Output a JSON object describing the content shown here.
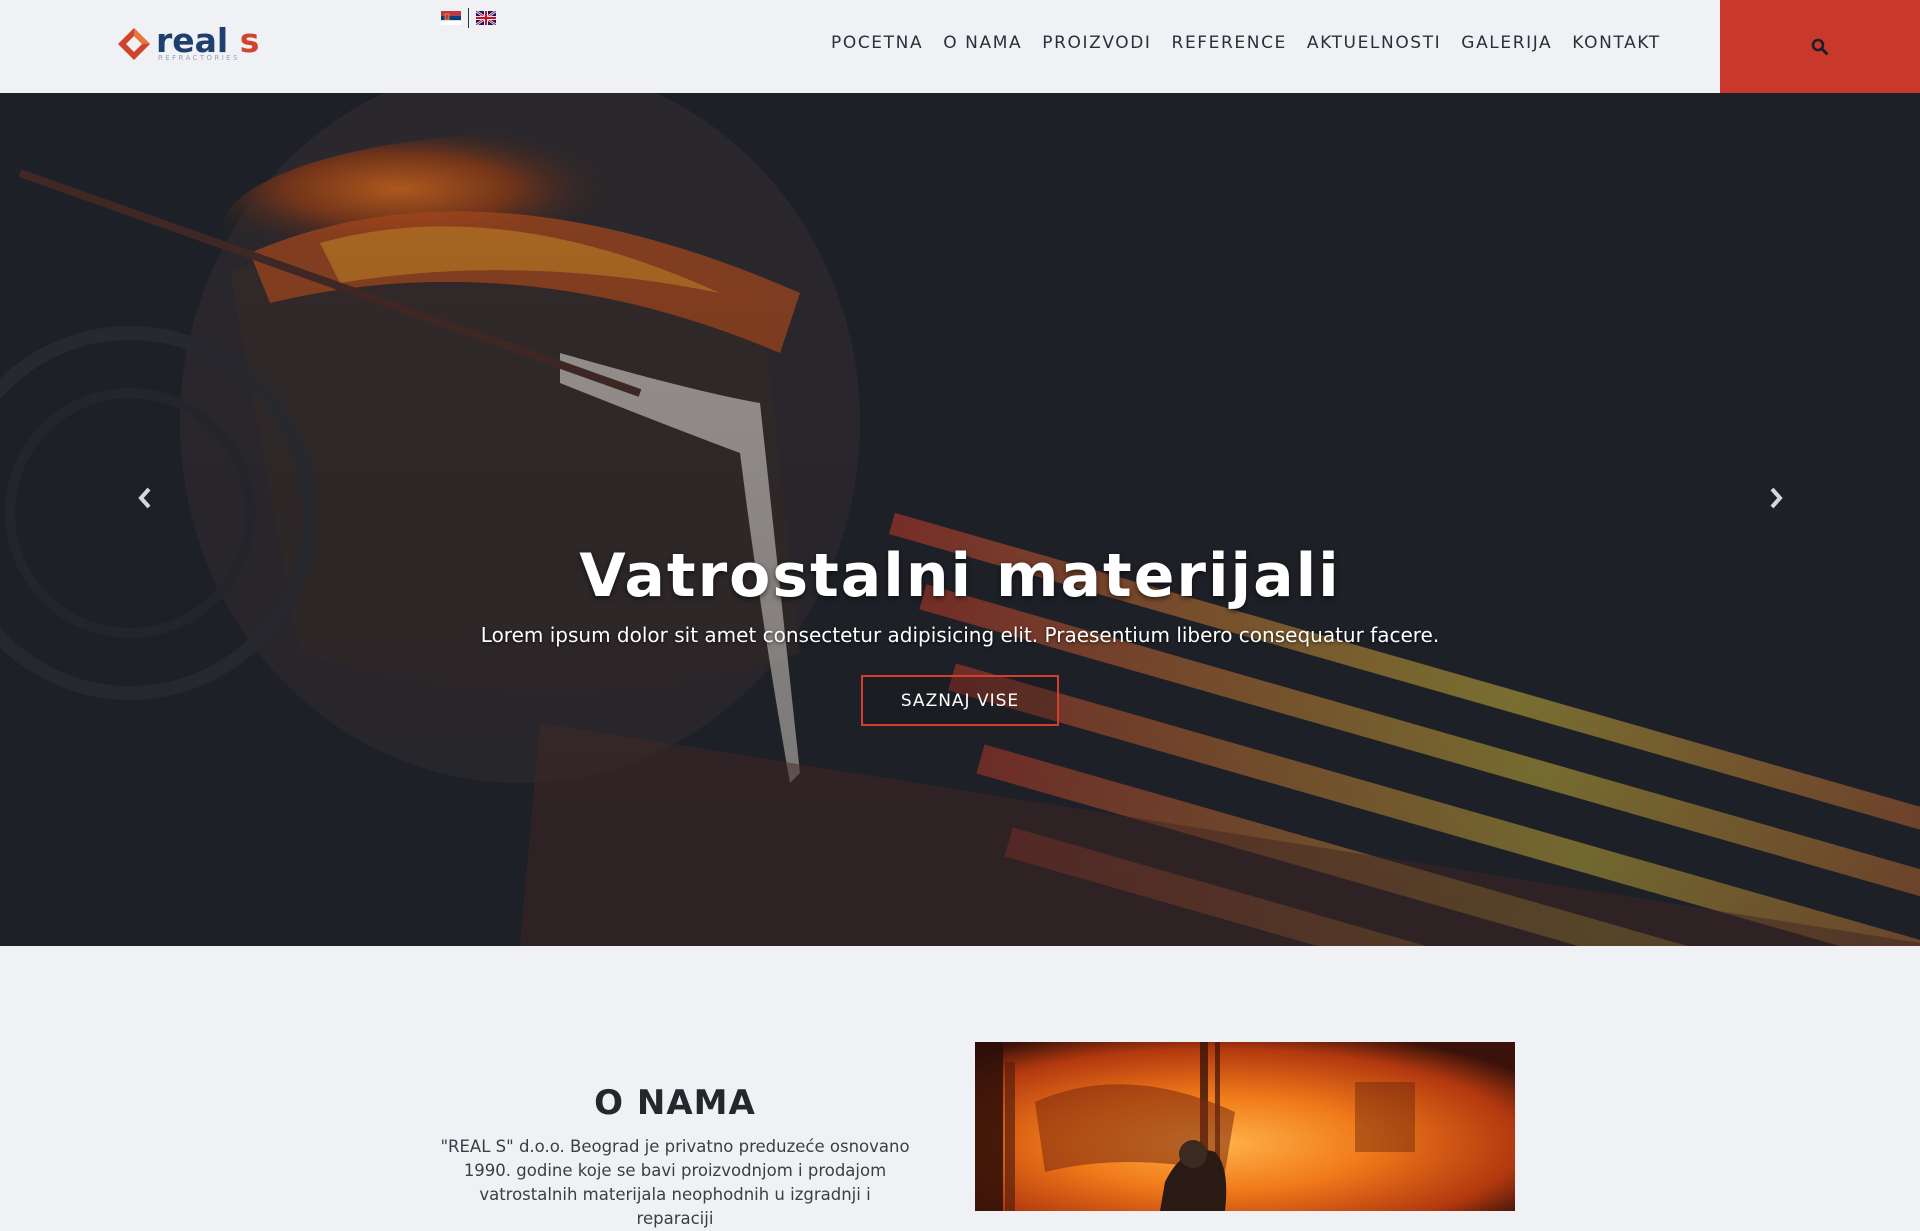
{
  "logo": {
    "word1": "real",
    "word2": "s",
    "subtitle": "REFRACTORIES"
  },
  "nav": {
    "items": [
      "POCETNA",
      "O NAMA",
      "PROIZVODI",
      "REFERENCE",
      "AKTUELNOSTI",
      "GALERIJA",
      "KONTAKT"
    ]
  },
  "hero": {
    "title": "Vatrostalni materijali",
    "subtitle": "Lorem ipsum dolor sit amet consectetur adipisicing elit. Praesentium libero consequatur facere.",
    "button_label": "SAZNAJ VISE"
  },
  "about": {
    "title": "O NAMA",
    "text": "\"REAL S\" d.o.o. Beograd je privatno preduzeće osnovano 1990. godine koje se bavi proizvodnjom i prodajom vatrostalnih materijala neophodnih u izgradnji i reparaciji"
  },
  "colors": {
    "accent": "#c9392b",
    "brand_blue": "#1f3f6e",
    "background": "#f0f1f5"
  },
  "icons": {
    "search": "search-icon",
    "prev": "chevron-left-icon",
    "next": "chevron-right-icon"
  }
}
